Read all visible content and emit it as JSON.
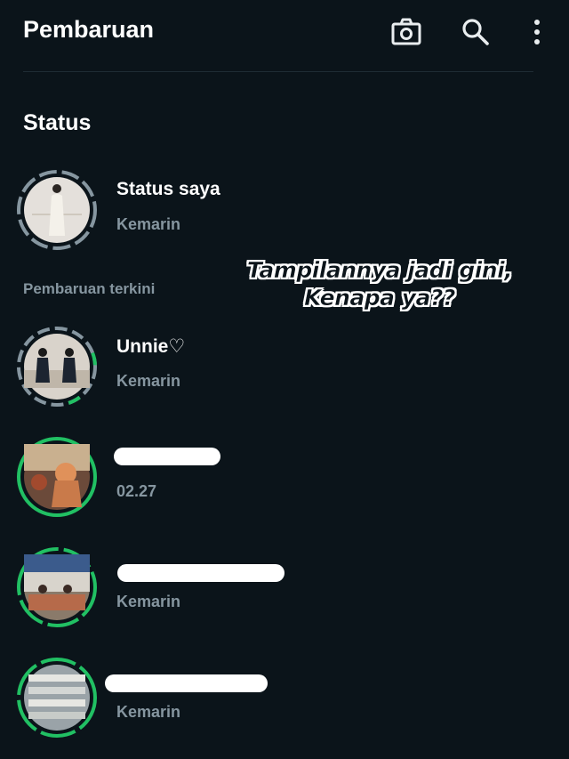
{
  "header": {
    "title": "Pembaruan",
    "icons": [
      "camera-icon",
      "search-icon",
      "more-vertical-icon"
    ]
  },
  "status_section": {
    "title": "Status",
    "my_status": {
      "name": "Status saya",
      "time": "Kemarin"
    },
    "recent_label": "Pembaruan terkini",
    "items": [
      {
        "name": "Unnie♡",
        "time": "Kemarin",
        "viewed": true
      },
      {
        "name": "",
        "time": "02.27",
        "viewed": false,
        "name_redacted": true
      },
      {
        "name": "",
        "time": "Kemarin",
        "viewed": false,
        "name_redacted": true
      },
      {
        "name": "",
        "time": "Kemarin",
        "viewed": false,
        "name_redacted": true
      }
    ]
  },
  "overlay_caption": {
    "line1": "Tampilannya jadi gini,",
    "line2": "Kenapa ya??"
  },
  "colors": {
    "background": "#0b141a",
    "accent_green": "#21c063",
    "muted_text": "#8696a0",
    "viewed_ring": "#8696a0"
  }
}
